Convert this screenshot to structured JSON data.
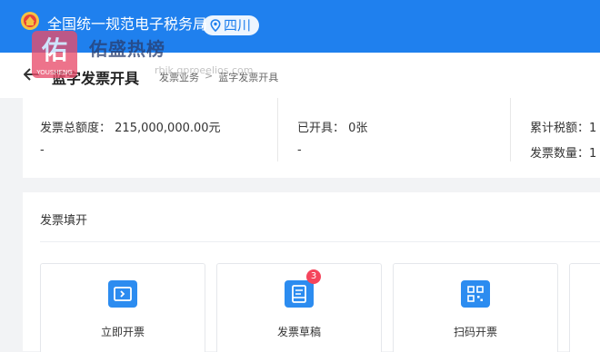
{
  "header": {
    "site_title": "全国统一规范电子税务局",
    "region": "四川"
  },
  "watermark": {
    "logo_char": "佑",
    "logo_sub": "YOUSHENG",
    "text": "佑盛热榜",
    "url": "rbjk.gproeelios.com"
  },
  "subheader": {
    "page_title": "蓝字发票开具",
    "breadcrumb": [
      "发票业务",
      "蓝字发票开具"
    ]
  },
  "stats": {
    "total_quota_label": "发票总额度：",
    "total_quota_value": "215,000,000.00元",
    "total_quota_sub": "-",
    "issued_label": "已开具：",
    "issued_value": "0张",
    "issued_sub": "-",
    "tax_total_label": "累计税额：",
    "tax_total_value": "1",
    "invoice_count_label": "发票数量：",
    "invoice_count_value": "1"
  },
  "panel": {
    "title": "发票填开",
    "cards": [
      {
        "label": "立即开票",
        "icon": "ticket-icon"
      },
      {
        "label": "发票草稿",
        "icon": "draft-icon",
        "badge": "3"
      },
      {
        "label": "扫码开票",
        "icon": "qrcode-icon"
      }
    ]
  },
  "colors": {
    "brand_blue": "#1f80ee",
    "card_icon_blue": "#2c8cf0",
    "badge_red": "#f5455c"
  }
}
